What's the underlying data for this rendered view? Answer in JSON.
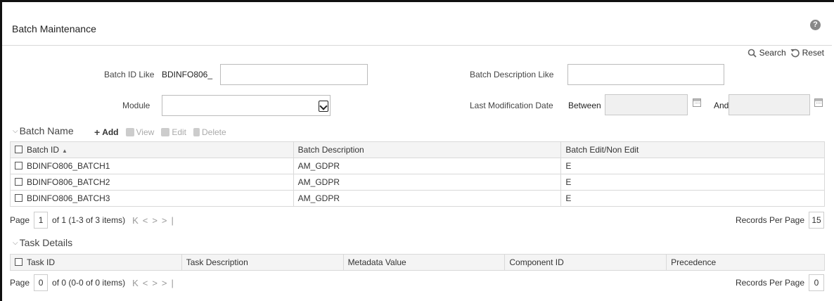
{
  "header": {
    "title": "Batch Maintenance",
    "help": "?"
  },
  "actions": {
    "search": "Search",
    "reset": "Reset"
  },
  "filters": {
    "batch_id_label": "Batch ID Like",
    "batch_id_value": "BDINFO806_",
    "batch_desc_label": "Batch Description Like",
    "batch_desc_value": "",
    "module_label": "Module",
    "module_value": "",
    "last_mod_label": "Last Modification Date",
    "between_label": "Between",
    "and_label": "And",
    "between_value": "",
    "and_value": ""
  },
  "batch": {
    "section_title": "Batch Name",
    "toolbar": {
      "add": "Add",
      "view": "View",
      "edit": "Edit",
      "delete": "Delete"
    },
    "columns": [
      "Batch ID",
      "Batch Description",
      "Batch Edit/Non Edit"
    ],
    "rows": [
      [
        "BDINFO806_BATCH1",
        "AM_GDPR",
        "E"
      ],
      [
        "BDINFO806_BATCH2",
        "AM_GDPR",
        "E"
      ],
      [
        "BDINFO806_BATCH3",
        "AM_GDPR",
        "E"
      ]
    ],
    "pager": {
      "page_label": "Page",
      "page": "1",
      "info": "of 1 (1-3 of 3 items)",
      "rpp_label": "Records Per Page",
      "rpp": "15"
    }
  },
  "tasks": {
    "section_title": "Task Details",
    "columns": [
      "Task ID",
      "Task Description",
      "Metadata Value",
      "Component ID",
      "Precedence"
    ],
    "pager": {
      "page_label": "Page",
      "page": "0",
      "info": "of 0 (0-0 of 0 items)",
      "rpp_label": "Records Per Page",
      "rpp": "0"
    }
  }
}
